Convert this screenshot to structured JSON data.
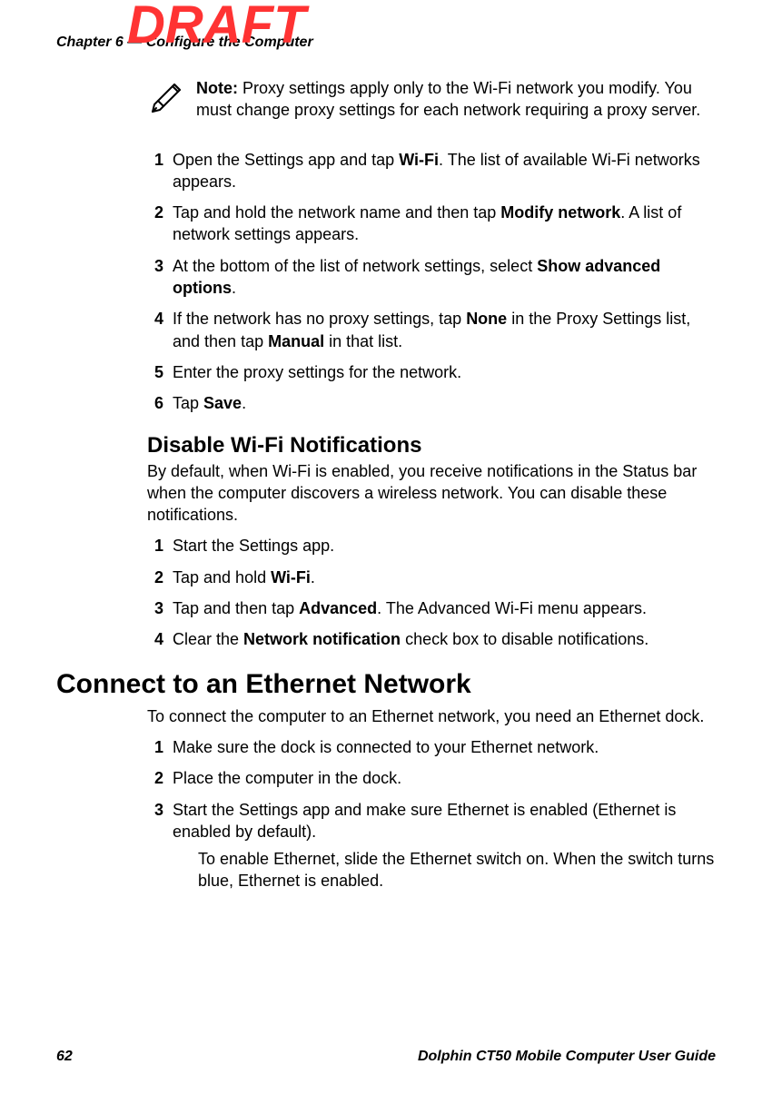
{
  "watermark": "DRAFT",
  "chapter_title": "Chapter 6 — Configure the Computer",
  "note": {
    "label": "Note:",
    "text": " Proxy settings apply only to the Wi-Fi network you modify. You must change proxy settings for each network requiring a proxy server."
  },
  "proxy_steps": {
    "s1": {
      "num": "1",
      "pre": "Open the Settings app and tap ",
      "b1": "Wi-Fi",
      "post": ". The list of available Wi-Fi networks appears."
    },
    "s2": {
      "num": "2",
      "pre": "Tap and hold the network name and then tap ",
      "b1": "Modify network",
      "post": ". A list of network settings appears."
    },
    "s3": {
      "num": "3",
      "pre": "At the bottom of the list of network settings, select ",
      "b1": "Show advanced options",
      "post": "."
    },
    "s4": {
      "num": "4",
      "pre": "If the network has no proxy settings, tap ",
      "b1": "None",
      "mid": " in the Proxy Settings list, and then tap ",
      "b2": "Manual",
      "post": " in that list."
    },
    "s5": {
      "num": "5",
      "text": "Enter the proxy settings for the network."
    },
    "s6": {
      "num": "6",
      "pre": "Tap ",
      "b1": "Save",
      "post": "."
    }
  },
  "wifi_notify": {
    "heading": "Disable Wi-Fi Notifications",
    "intro": "By default, when Wi-Fi is enabled, you receive notifications in the Status bar when the computer discovers a wireless network. You can disable these notifications.",
    "s1": {
      "num": "1",
      "text": "Start the Settings app."
    },
    "s2": {
      "num": "2",
      "pre": "Tap and hold ",
      "b1": "Wi-Fi",
      "post": "."
    },
    "s3": {
      "num": "3",
      "pre": "Tap and then tap ",
      "b1": "Advanced",
      "post": ". The Advanced Wi-Fi menu appears."
    },
    "s4": {
      "num": "4",
      "pre": "Clear the ",
      "b1": "Network notification",
      "post": " check box to disable notifications."
    }
  },
  "ethernet": {
    "heading": "Connect to an Ethernet Network",
    "intro": "To connect the computer to an Ethernet network, you need an Ethernet dock.",
    "s1": {
      "num": "1",
      "text": "Make sure the dock is connected to your Ethernet network."
    },
    "s2": {
      "num": "2",
      "text": "Place the computer in the dock."
    },
    "s3": {
      "num": "3",
      "text": "Start the Settings app and make sure Ethernet is enabled (Ethernet is enabled by default).",
      "sub": "To enable Ethernet, slide the Ethernet switch on. When the switch turns blue, Ethernet is enabled."
    }
  },
  "footer": {
    "page_number": "62",
    "guide_title": "Dolphin CT50 Mobile Computer User Guide"
  }
}
